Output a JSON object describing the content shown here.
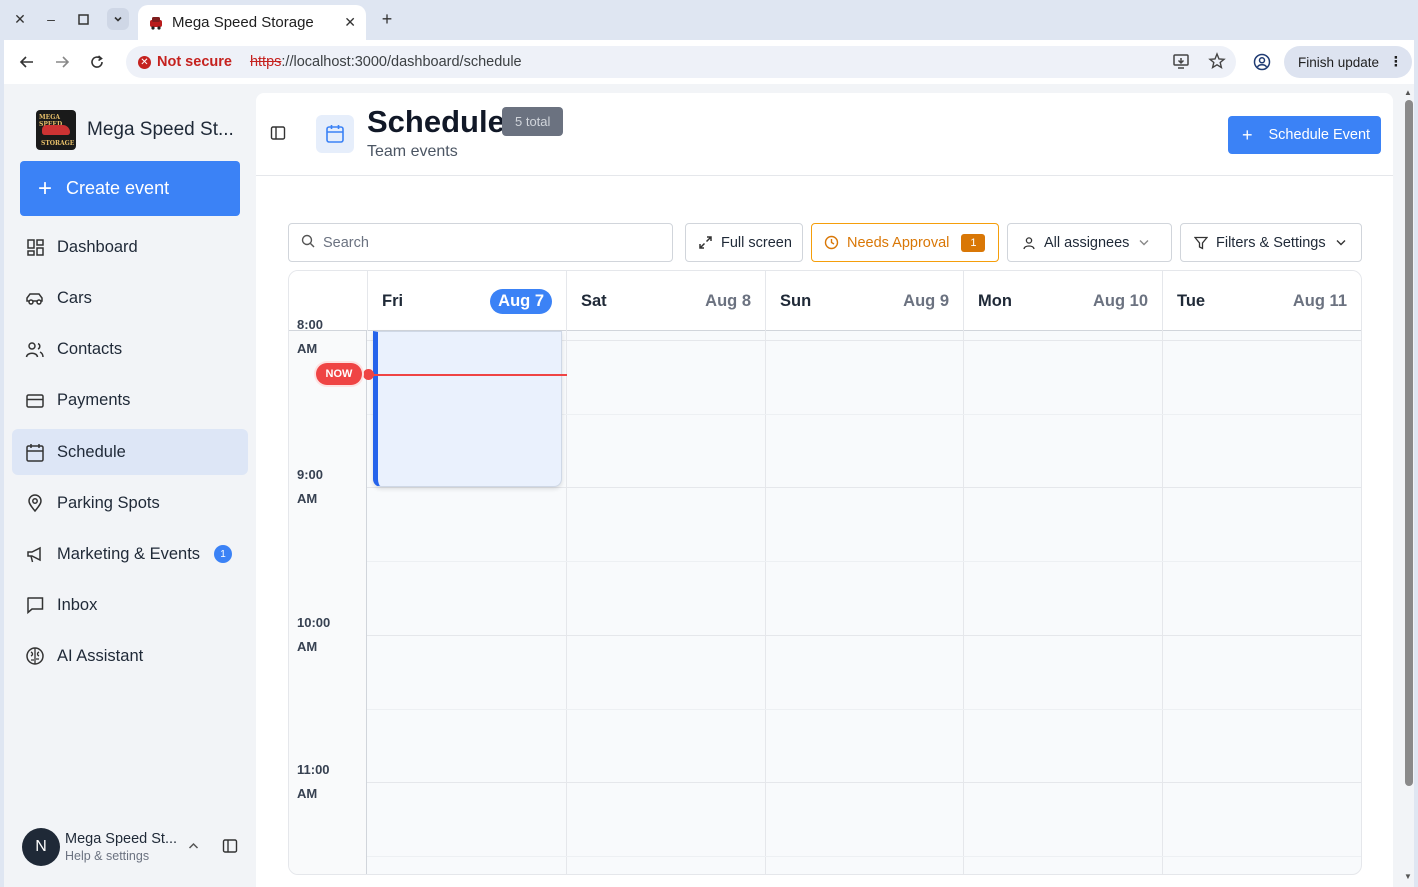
{
  "browser": {
    "tab_title": "Mega Speed Storage",
    "security_label": "Not secure",
    "url_scheme": "https",
    "url_rest": "://localhost:3000/dashboard/schedule",
    "finish_update": "Finish update"
  },
  "sidebar": {
    "brand_name": "Mega Speed St...",
    "logo_text_top": "MEGA SPEED",
    "logo_text_bottom": "STORAGE",
    "create_label": "Create event",
    "items": [
      {
        "label": "Dashboard",
        "icon": "dashboard-icon"
      },
      {
        "label": "Cars",
        "icon": "car-icon"
      },
      {
        "label": "Contacts",
        "icon": "users-icon"
      },
      {
        "label": "Payments",
        "icon": "credit-card-icon"
      },
      {
        "label": "Schedule",
        "icon": "calendar-icon",
        "active": true
      },
      {
        "label": "Parking Spots",
        "icon": "map-pin-icon"
      },
      {
        "label": "Marketing & Events",
        "icon": "megaphone-icon",
        "badge": "1"
      },
      {
        "label": "Inbox",
        "icon": "message-icon"
      },
      {
        "label": "AI Assistant",
        "icon": "brain-icon"
      }
    ],
    "user": {
      "initial": "N",
      "name": "Mega Speed St...",
      "sub": "Help & settings"
    }
  },
  "header": {
    "title": "Schedule",
    "total_badge": "5 total",
    "subtitle": "Team events",
    "schedule_button": "Schedule Event"
  },
  "toolbar": {
    "search_placeholder": "Search",
    "fullscreen": "Full screen",
    "needs_approval": "Needs Approval",
    "needs_approval_count": "1",
    "assignees": "All assignees",
    "filters": "Filters & Settings"
  },
  "calendar": {
    "days": [
      {
        "name": "Fri",
        "date": "Aug 7",
        "today": true
      },
      {
        "name": "Sat",
        "date": "Aug 8"
      },
      {
        "name": "Sun",
        "date": "Aug 9"
      },
      {
        "name": "Mon",
        "date": "Aug 10"
      },
      {
        "name": "Tue",
        "date": "Aug 11"
      }
    ],
    "times": [
      {
        "hour": "8:00",
        "ampm": "AM"
      },
      {
        "hour": "9:00",
        "ampm": "AM"
      },
      {
        "hour": "10:00",
        "ampm": "AM"
      },
      {
        "hour": "11:00",
        "ampm": "AM"
      }
    ],
    "now_label": "NOW"
  },
  "colors": {
    "accent": "#3b82f6",
    "now": "#ef4444",
    "approval": "#d97706"
  }
}
